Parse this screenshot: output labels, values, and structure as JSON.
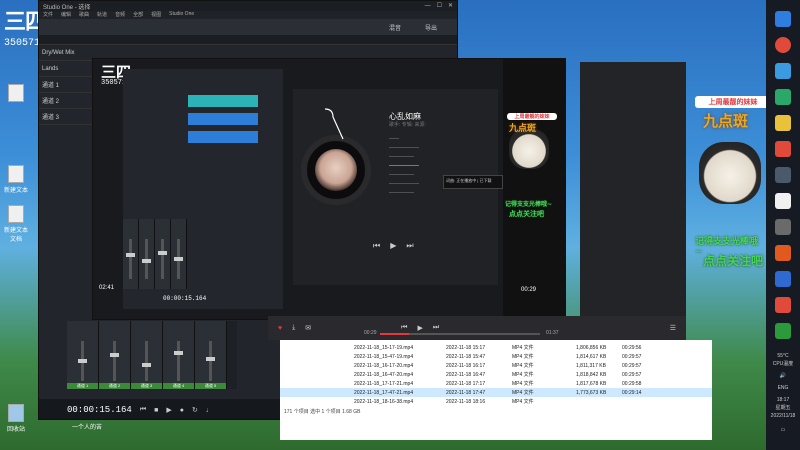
{
  "overlay": {
    "logo": "三四",
    "user_id": "3505717"
  },
  "desktop_icons": [
    {
      "label": "新建文本"
    },
    {
      "label": "新建文本文档"
    },
    {
      "label": "回收站"
    }
  ],
  "daw": {
    "title": "Studio One - 选择",
    "menus": [
      "文件",
      "编辑",
      "歌曲",
      "轨道",
      "音频",
      "全部",
      "视图",
      "Studio One"
    ],
    "tracks": [
      "Dry/Wet Mix",
      "Lands",
      "通道 1",
      "通道 2",
      "通道 3"
    ],
    "time": "00:00:15.164",
    "small_time": "00:00:15.164",
    "channel_names": [
      "通道 1",
      "通道 2",
      "通道 3",
      "通道 4",
      "通道 5"
    ],
    "left_time": "02:41",
    "toolbar": [
      "混音",
      "导出"
    ]
  },
  "player": {
    "song_title": "心乱如麻",
    "meta": "歌手: 专辑: 来源:",
    "lyrics": [
      "——",
      "——————",
      "—————",
      "——————",
      "—————",
      "——————",
      "—————"
    ],
    "lyric_active_index": 3,
    "popup": "词曲: 正在播放中 | 已下载",
    "time": "00:29",
    "mini_time": "00:29",
    "total": "01:37"
  },
  "explorer": {
    "files": [
      {
        "name": "2022-11-18_15-17-19.mp4",
        "date": "2022-11-18 15:17",
        "type": "MP4 文件",
        "size": "1,806,856 KB",
        "dur": "00:29:56"
      },
      {
        "name": "2022-11-18_15-47-19.mp4",
        "date": "2022-11-18 15:47",
        "type": "MP4 文件",
        "size": "1,814,617 KB",
        "dur": "00:29:57"
      },
      {
        "name": "2022-11-18_16-17-20.mp4",
        "date": "2022-11-18 16:17",
        "type": "MP4 文件",
        "size": "1,811,317 KB",
        "dur": "00:29:57"
      },
      {
        "name": "2022-11-18_16-47-20.mp4",
        "date": "2022-11-18 16:47",
        "type": "MP4 文件",
        "size": "1,818,842 KB",
        "dur": "00:29:57"
      },
      {
        "name": "2022-11-18_17-17-21.mp4",
        "date": "2022-11-18 17:17",
        "type": "MP4 文件",
        "size": "1,817,678 KB",
        "dur": "00:29:58"
      },
      {
        "name": "2022-11-18_17-47-21.mp4",
        "date": "2022-11-18 17:47",
        "type": "MP4 文件",
        "size": "1,773,673 KB",
        "dur": "00:29:14"
      },
      {
        "name": "2022-11-18_18-16-38.mp4",
        "date": "2022-11-18 18:16",
        "type": "MP4 文件",
        "size": "",
        "dur": ""
      }
    ],
    "status": "171 个项目  选中 1 个项目  1.68 GB"
  },
  "stickers": {
    "title": "上周最靓的妹妹",
    "big": "九点斑",
    "green1": "记得支支光棒哦~",
    "green2": "点点关注吧"
  },
  "bottom_bar": {
    "chat": "一个人的苦"
  },
  "taskbar": {
    "temp": "55°C",
    "temp_label": "CPU温度",
    "lang": "ENG",
    "clock": "18:17",
    "weekday": "星期五",
    "date": "2022/11/18"
  },
  "colors": {
    "accent": "#2bb3b8",
    "mixer_green": "#3a8a3a",
    "sticker_red": "#e0393e"
  }
}
